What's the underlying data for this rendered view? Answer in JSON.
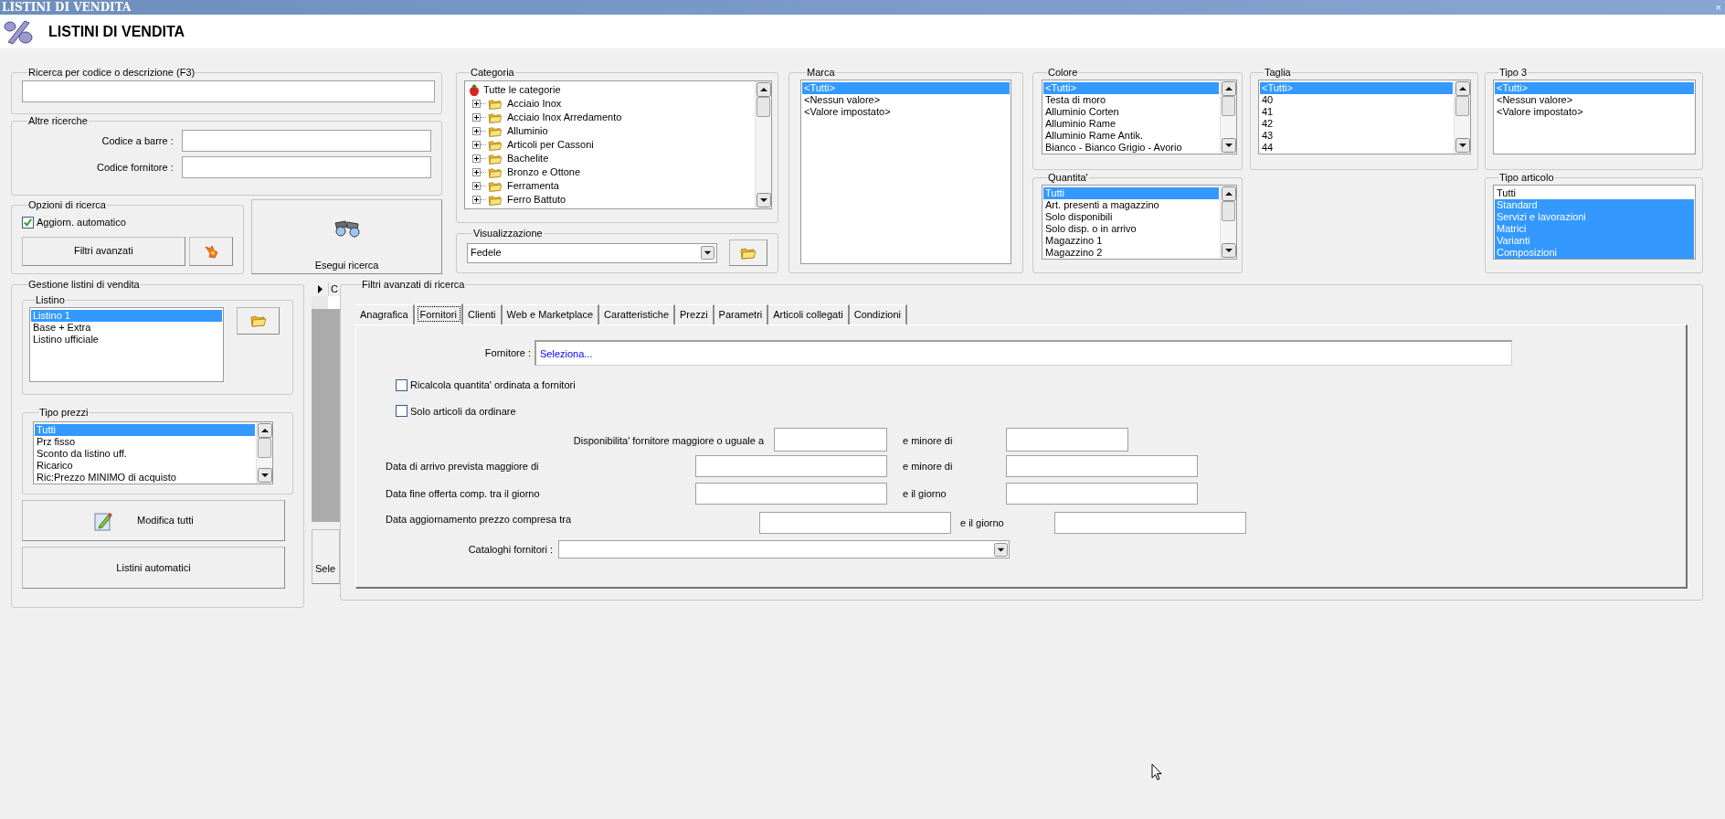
{
  "window": {
    "title": "LISTINI DI VENDITA",
    "close": "×"
  },
  "header": {
    "title": "LISTINI DI VENDITA"
  },
  "search": {
    "label": "Ricerca per codice o descrizione (F3)"
  },
  "other_searches": {
    "label": "Altre ricerche",
    "fields": [
      {
        "label": "Codice a barre :"
      },
      {
        "label": "Codice fornitore :"
      }
    ]
  },
  "search_options": {
    "label": "Opzioni di ricerca",
    "auto_update": {
      "label": "Aggiorn. automatico",
      "checked": true
    },
    "filters_button": "Filtri avanzati"
  },
  "run_search_button": "Esegui ricerca",
  "category": {
    "label": "Categoria",
    "root": "Tutte le categorie",
    "children": [
      {
        "label": "Acciaio Inox",
        "expanded": false
      },
      {
        "label": "Acciaio Inox Arredamento",
        "expanded": false
      },
      {
        "label": "Alluminio",
        "expanded": false
      },
      {
        "label": "Articoli per Cassoni",
        "expanded": false
      },
      {
        "label": "Bachelite",
        "expanded": false
      },
      {
        "label": "Bronzo e Ottone",
        "expanded": false
      },
      {
        "label": "Ferramenta",
        "expanded": false
      },
      {
        "label": "Ferro Battuto",
        "expanded": false
      }
    ]
  },
  "display": {
    "label": "Visualizzazione",
    "value": "Fedele"
  },
  "brand": {
    "label": "Marca",
    "items": [
      {
        "text": "<Tutti>",
        "selected": true
      },
      {
        "text": "<Nessun valore>",
        "selected": false
      },
      {
        "text": "<Valore impostato>",
        "selected": false
      }
    ]
  },
  "color": {
    "label": "Colore",
    "kind": "scrolling",
    "items": [
      {
        "text": "<Tutti>",
        "selected": true
      },
      {
        "text": "Testa di moro",
        "selected": false
      },
      {
        "text": "Alluminio Corten",
        "selected": false
      },
      {
        "text": "Alluminio Rame",
        "selected": false
      },
      {
        "text": "Alluminio Rame Antik.",
        "selected": false
      },
      {
        "text": "Bianco - Bianco Grigio - Avorio",
        "selected": false
      }
    ]
  },
  "quantity": {
    "label": "Quantita'",
    "kind": "scrolling",
    "items": [
      {
        "text": "Tutti",
        "selected": true
      },
      {
        "text": "Art. presenti a magazzino",
        "selected": false
      },
      {
        "text": "Solo disponibili",
        "selected": false
      },
      {
        "text": "Solo disp. o in arrivo",
        "selected": false
      },
      {
        "text": "Magazzino 1",
        "selected": false
      },
      {
        "text": "Magazzino 2",
        "selected": false
      }
    ]
  },
  "size": {
    "label": "Taglia",
    "kind": "scrolling",
    "items": [
      {
        "text": "<Tutti>",
        "selected": true
      },
      {
        "text": "40",
        "selected": false
      },
      {
        "text": "41",
        "selected": false
      },
      {
        "text": "42",
        "selected": false
      },
      {
        "text": "43",
        "selected": false
      },
      {
        "text": "44",
        "selected": false
      }
    ]
  },
  "type_3": {
    "label": "Tipo 3",
    "items": [
      {
        "text": "<Tutti>",
        "selected": true
      },
      {
        "text": "<Nessun valore>",
        "selected": false
      },
      {
        "text": "<Valore impostato>",
        "selected": false
      }
    ]
  },
  "item_type": {
    "label": "Tipo articolo",
    "items": [
      {
        "text": "Tutti",
        "selected": false
      },
      {
        "text": "Standard",
        "selected": true
      },
      {
        "text": "Servizi e lavorazioni",
        "selected": true
      },
      {
        "text": "Matrici",
        "selected": true
      },
      {
        "text": "Varianti",
        "selected": true
      },
      {
        "text": "Composizioni",
        "selected": true
      }
    ]
  },
  "price_lists": {
    "label": "Gestione listini di vendita",
    "list": {
      "label": "Listino",
      "items": [
        {
          "text": "Listino 1",
          "selected": true
        },
        {
          "text": "Base + Extra",
          "selected": false
        },
        {
          "text": "Listino ufficiale",
          "selected": false
        }
      ]
    },
    "price_type": {
      "label": "Tipo prezzi",
      "kind": "scrolling",
      "items": [
        {
          "text": "Tutti",
          "selected": true
        },
        {
          "text": "Prz fisso",
          "selected": false
        },
        {
          "text": "Sconto da listino uff.",
          "selected": false
        },
        {
          "text": "Ricarico",
          "selected": false
        },
        {
          "text": "Ric:Prezzo MINIMO di acquisto",
          "selected": false
        }
      ]
    },
    "edit_all_button": "Modifica tutti",
    "auto_lists_button": "Listini automatici"
  },
  "results": {
    "column_1": "C",
    "button": "Sele"
  },
  "advanced_filters": {
    "label": "Filtri avanzati di ricerca",
    "tabs": [
      {
        "label": "Anagrafica",
        "selected": false
      },
      {
        "label": "Fornitori",
        "selected": true
      },
      {
        "label": "Clienti",
        "selected": false
      },
      {
        "label": "Web e Marketplace",
        "selected": false
      },
      {
        "label": "Caratteristiche",
        "selected": false
      },
      {
        "label": "Prezzi",
        "selected": false
      },
      {
        "label": "Parametri",
        "selected": false
      },
      {
        "label": "Articoli collegati",
        "selected": false
      },
      {
        "label": "Condizioni",
        "selected": false
      }
    ],
    "supplier": {
      "label": "Fornitore :",
      "value": "Seleziona..."
    },
    "checkboxes": [
      {
        "label": "Ricalcola quantita' ordinata a fornitori",
        "checked": false
      },
      {
        "label": "Solo articoli da ordinare",
        "checked": false
      }
    ],
    "ranges": [
      {
        "label": "Disponibilita' fornitore maggiore o uguale a",
        "and_label": "e minore di"
      },
      {
        "label": "Data di arrivo prevista maggiore di",
        "and_label": "e minore di"
      },
      {
        "label": "Data fine offerta comp. tra il giorno",
        "and_label": "e il giorno"
      },
      {
        "label": "Data aggiornamento prezzo compresa tra",
        "and_label": "e il giorno"
      }
    ],
    "catalogs": {
      "label": "Cataloghi fornitori :"
    }
  }
}
